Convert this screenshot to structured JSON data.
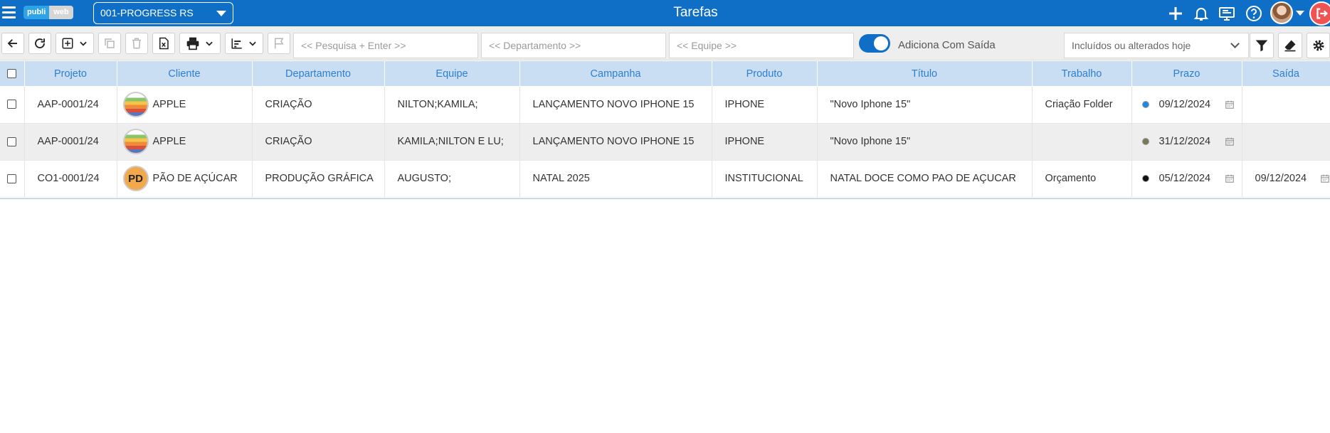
{
  "app": {
    "title": "Tarefas",
    "logo_left": "publi",
    "logo_right": "web",
    "company": "001-PROGRESS RS"
  },
  "topbar_icons": [
    "plus-icon",
    "bell-icon",
    "monitor-icon",
    "help-icon",
    "user-avatar",
    "logout-icon"
  ],
  "toolbar": {
    "search_placeholder": "<< Pesquisa + Enter >>",
    "department_placeholder": "<< Departamento >>",
    "team_placeholder": "<< Equipe >>",
    "toggle_label": "Adiciona Com Saída",
    "toggle_on": true,
    "filter_value": "Incluídos ou alterados hoje"
  },
  "table": {
    "columns": [
      "Projeto",
      "Cliente",
      "Departamento",
      "Equipe",
      "Campanha",
      "Produto",
      "Título",
      "Trabalho",
      "Prazo",
      "Saída"
    ],
    "rows": [
      {
        "projeto": "AAP-0001/24",
        "cliente": "APPLE",
        "cliente_logo": "apple",
        "departamento": "CRIAÇÃO",
        "equipe": "NILTON;KAMILA;",
        "campanha": "LANÇAMENTO NOVO IPHONE 15",
        "produto": "IPHONE",
        "titulo": "\"Novo Iphone 15\"",
        "trabalho": "Criação Folder",
        "prazo": "09/12/2024",
        "status_color": "#1e88e5",
        "saida": ""
      },
      {
        "projeto": "AAP-0001/24",
        "cliente": "APPLE",
        "cliente_logo": "apple",
        "departamento": "CRIAÇÃO",
        "equipe": "KAMILA;NILTON E LU;",
        "campanha": "LANÇAMENTO NOVO IPHONE 15",
        "produto": "IPHONE",
        "titulo": "\"Novo Iphone 15\"",
        "trabalho": "",
        "prazo": "31/12/2024",
        "status_color": "#7a7a55",
        "saida": ""
      },
      {
        "projeto": "CO1-0001/24",
        "cliente": "PÃO DE AÇÚCAR",
        "cliente_logo": "PD",
        "departamento": "PRODUÇÃO GRÁFICA",
        "equipe": "AUGUSTO;",
        "campanha": "NATAL 2025",
        "produto": "INSTITUCIONAL",
        "titulo": "NATAL DOCE COMO PAO DE AÇUCAR",
        "trabalho": "Orçamento",
        "prazo": "05/12/2024",
        "status_color": "#111111",
        "saida": "09/12/2024"
      }
    ]
  },
  "colors": {
    "primary": "#0f6fc6",
    "header_bg": "#c9def2",
    "header_text": "#2d7fd0",
    "logout": "#ef5454"
  }
}
